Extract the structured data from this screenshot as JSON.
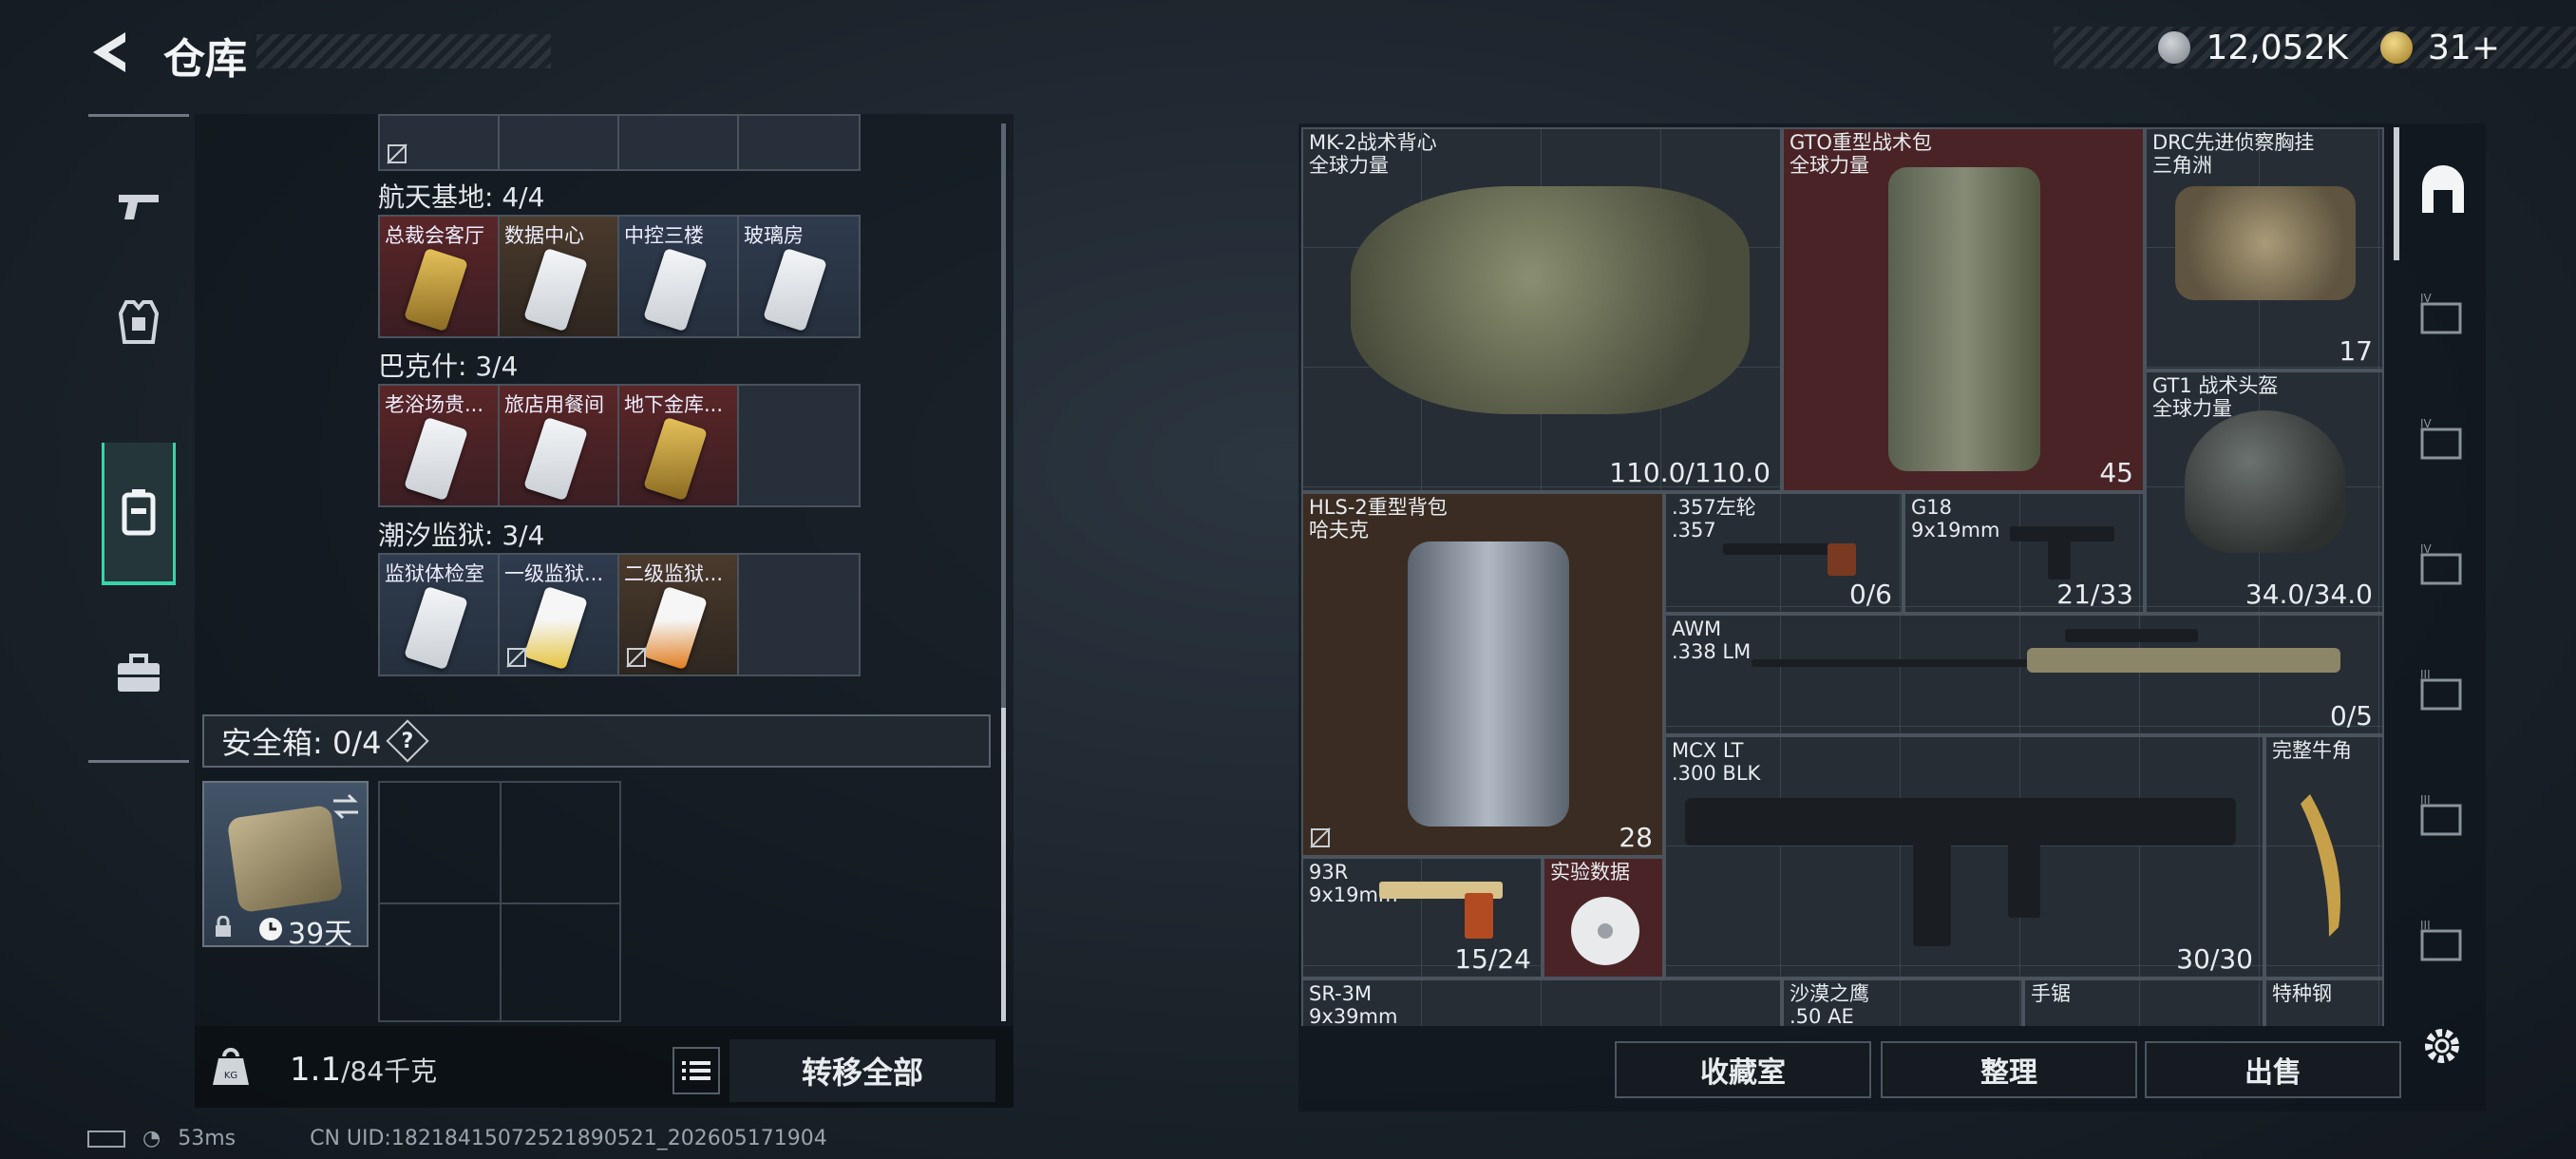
{
  "header": {
    "title": "仓库",
    "currency_coin": "12,052K",
    "currency_token": "31+"
  },
  "left_nav": [
    {
      "icon": "pistol-icon"
    },
    {
      "icon": "armor-vest-icon"
    },
    {
      "icon": "backpack-icon",
      "active": true
    },
    {
      "icon": "briefcase-icon"
    }
  ],
  "sections": [
    {
      "title": "航天基地: 4/4",
      "cards": [
        {
          "label": "总裁会客厅",
          "bg": "red",
          "card": "gold"
        },
        {
          "label": "数据中心",
          "bg": "brown",
          "card": "white"
        },
        {
          "label": "中控三楼",
          "bg": "blue",
          "card": "white"
        },
        {
          "label": "玻璃房",
          "bg": "blue",
          "card": "white"
        }
      ]
    },
    {
      "title": "巴克什: 3/4",
      "cards": [
        {
          "label": "老浴场贵...",
          "bg": "red",
          "card": "white"
        },
        {
          "label": "旅店用餐间",
          "bg": "red",
          "card": "white"
        },
        {
          "label": "地下金库...",
          "bg": "red",
          "card": "gold"
        }
      ]
    },
    {
      "title": "潮汐监狱: 3/4",
      "cards": [
        {
          "label": "监狱体检室",
          "bg": "blue",
          "card": "white"
        },
        {
          "label": "一级监狱...",
          "bg": "blue",
          "card": "yellow"
        },
        {
          "label": "二级监狱...",
          "bg": "brown",
          "card": "orange"
        }
      ]
    }
  ],
  "safe_box": {
    "label": "安全箱: 0/4",
    "help": "?",
    "timer": "39天"
  },
  "weight": {
    "current": "1.1",
    "max": "/84千克"
  },
  "transfer_all": "转移全部",
  "items": [
    {
      "name": "MK-2战术背心",
      "sub": "全球力量",
      "value": "110.0/110.0"
    },
    {
      "name": "GTO重型战术包",
      "sub": "全球力量",
      "value": "45"
    },
    {
      "name": "DRC先进侦察胸挂",
      "sub": "三角洲",
      "value": "17"
    },
    {
      "name": "GT1 战术头盔",
      "sub": "全球力量",
      "value": "34.0/34.0"
    },
    {
      "name": "HLS-2重型背包",
      "sub": "哈夫克",
      "value": "28"
    },
    {
      "name": ".357左轮",
      "sub": ".357",
      "value": "0/6"
    },
    {
      "name": "G18",
      "sub": "9x19mm",
      "value": "21/33"
    },
    {
      "name": "AWM",
      "sub": ".338 LM",
      "value": "0/5"
    },
    {
      "name": "MCX LT",
      "sub": ".300 BLK",
      "value": "30/30"
    },
    {
      "name": "完整牛角",
      "sub": "",
      "value": ""
    },
    {
      "name": "93R",
      "sub": "9x19mm",
      "value": "15/24"
    },
    {
      "name": "实验数据",
      "sub": "",
      "value": ""
    },
    {
      "name": "SR-3M",
      "sub": "9x39mm",
      "value": ""
    },
    {
      "name": "沙漠之鹰",
      "sub": ".50 AE",
      "value": ""
    },
    {
      "name": "手锯",
      "sub": "",
      "value": ""
    },
    {
      "name": "特种钢",
      "sub": "",
      "value": ""
    }
  ],
  "bottom_buttons": {
    "collection": "收藏室",
    "sort": "整理",
    "sell": "出售"
  },
  "status": {
    "ping": "53ms",
    "uid": "CN UID:18218415072521890521_202605171904"
  }
}
